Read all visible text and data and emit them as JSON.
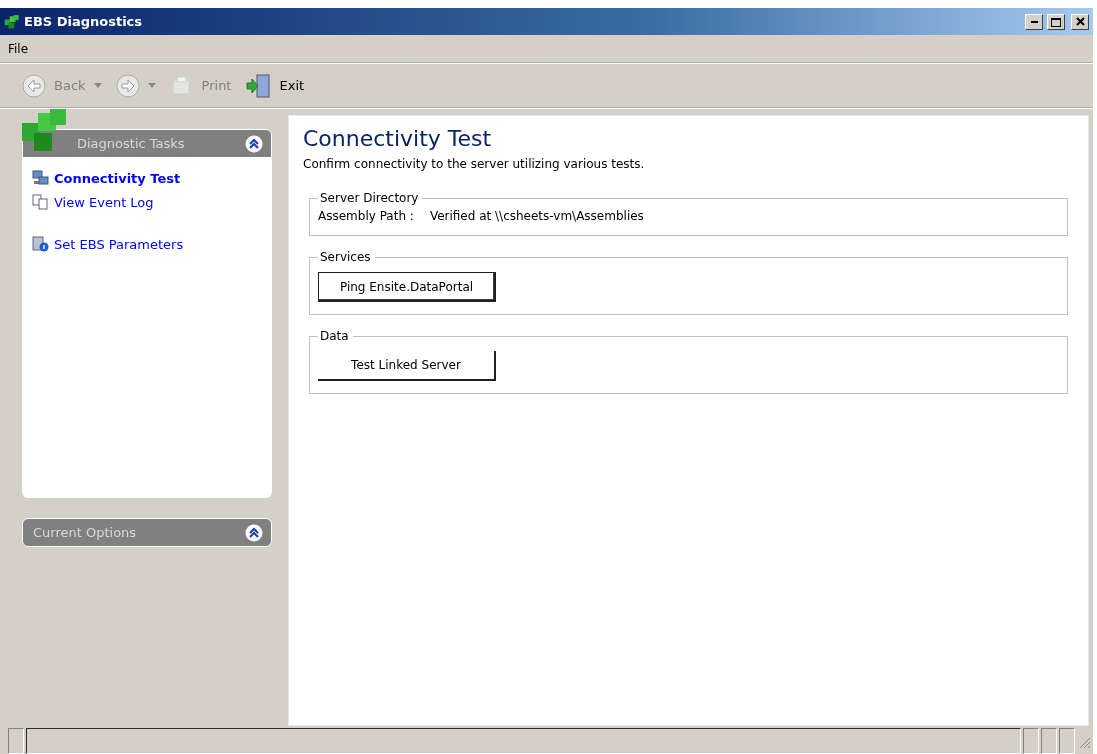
{
  "window": {
    "title": "EBS Diagnostics"
  },
  "menu": [
    {
      "label": "File"
    }
  ],
  "toolbar": [
    {
      "kind": "back",
      "label": "Back",
      "disabled": true
    },
    {
      "kind": "forward",
      "disabled": true
    },
    {
      "kind": "print",
      "label": "Print",
      "disabled": true
    },
    {
      "kind": "exit",
      "label": "Exit",
      "disabled": false
    }
  ],
  "sidebar": {
    "panels": [
      {
        "title": "Diagnostic Tasks",
        "expanded": true,
        "items": [
          {
            "kind": "network",
            "label": "Connectivity Test",
            "selected": true
          },
          {
            "kind": "pages",
            "label": "View Event Log",
            "selected": false
          },
          {
            "kind": "params",
            "label": "Set EBS Parameters",
            "selected": false
          }
        ]
      },
      {
        "title": "Current Options",
        "expanded": false
      }
    ]
  },
  "content": {
    "title": "Connectivity Test",
    "description": "Confirm connectivity to the server utilizing various tests.",
    "groups": [
      {
        "title": "Server Directory",
        "kind": "field",
        "label": "Assembly Path :",
        "value": "Verified at \\\\csheets-vm\\Assemblies"
      },
      {
        "title": "Services",
        "kind": "button",
        "button": "Ping Ensite.DataPortal",
        "default": true
      },
      {
        "title": "Data",
        "kind": "button",
        "button": "Test Linked Server",
        "default": false
      }
    ]
  }
}
